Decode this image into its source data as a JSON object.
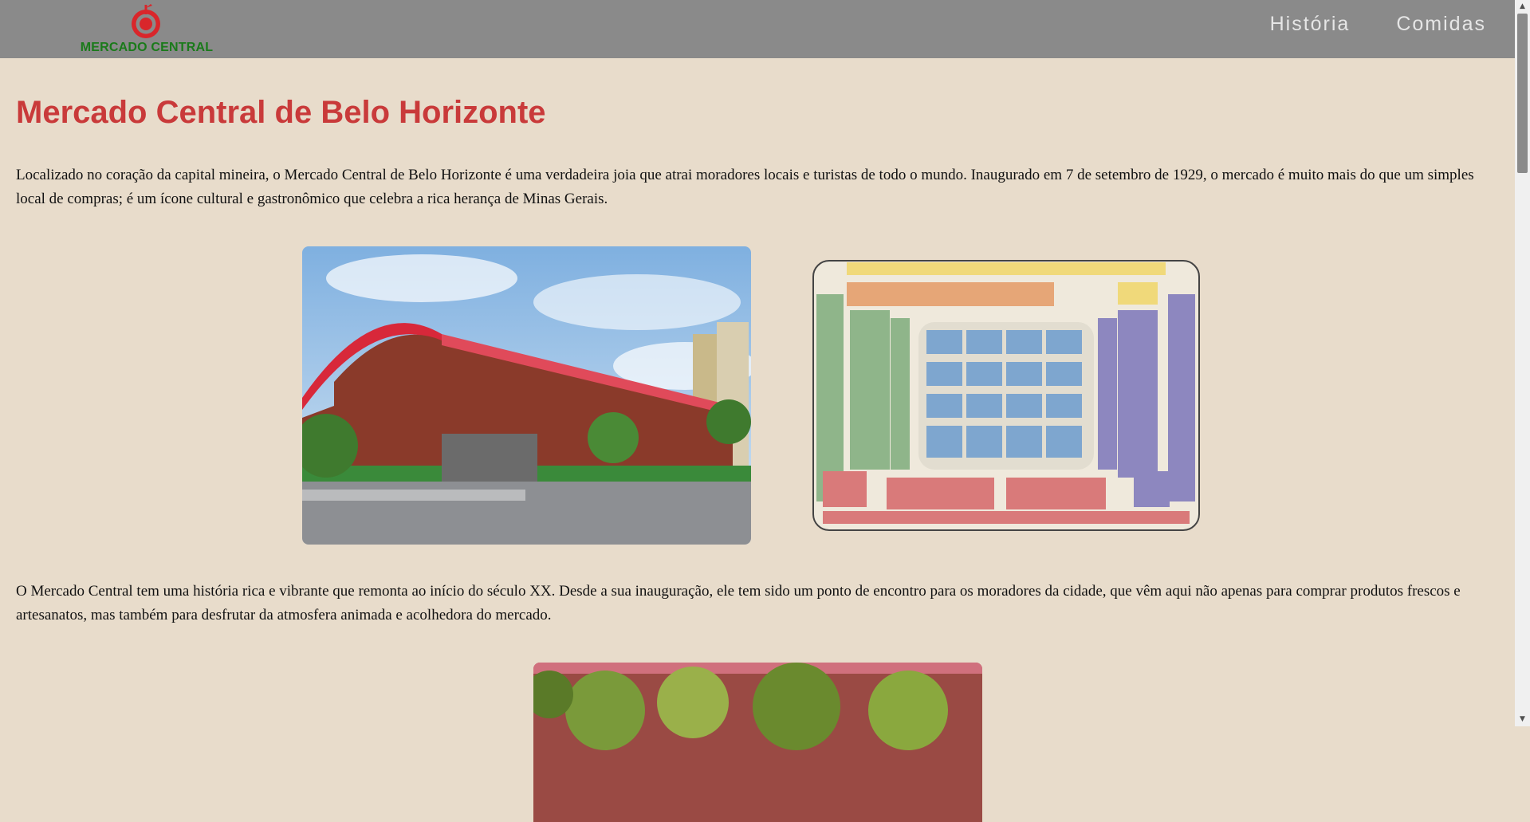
{
  "header": {
    "logo_text": "MERCADO CENTRAL",
    "nav": [
      {
        "label": "História"
      },
      {
        "label": "Comidas"
      }
    ]
  },
  "main": {
    "title": "Mercado Central de Belo Horizonte",
    "paragraph1": "Localizado no coração da capital mineira, o Mercado Central de Belo Horizonte é uma verdadeira joia que atrai moradores locais e turistas de todo o mundo. Inaugurado em 7 de setembro de 1929, o mercado é muito mais do que um simples local de compras; é um ícone cultural e gastronômico que celebra a rica herança de Minas Gerais.",
    "paragraph2": "O Mercado Central tem uma história rica e vibrante que remonta ao início do século XX. Desde a sua inauguração, ele tem sido um ponto de encontro para os moradores da cidade, que vêm aqui não apenas para comprar produtos frescos e artesanatos, mas também para desfrutar da atmosfera animada e acolhedora do mercado."
  },
  "colors": {
    "header_bg": "#8a8a8a",
    "page_bg": "#e8dccb",
    "title": "#c93a3a",
    "logo_red": "#d9262b",
    "logo_green": "#1a7a1a"
  },
  "icons": [
    "market-logo-icon",
    "scroll-up-icon",
    "scroll-down-icon"
  ]
}
